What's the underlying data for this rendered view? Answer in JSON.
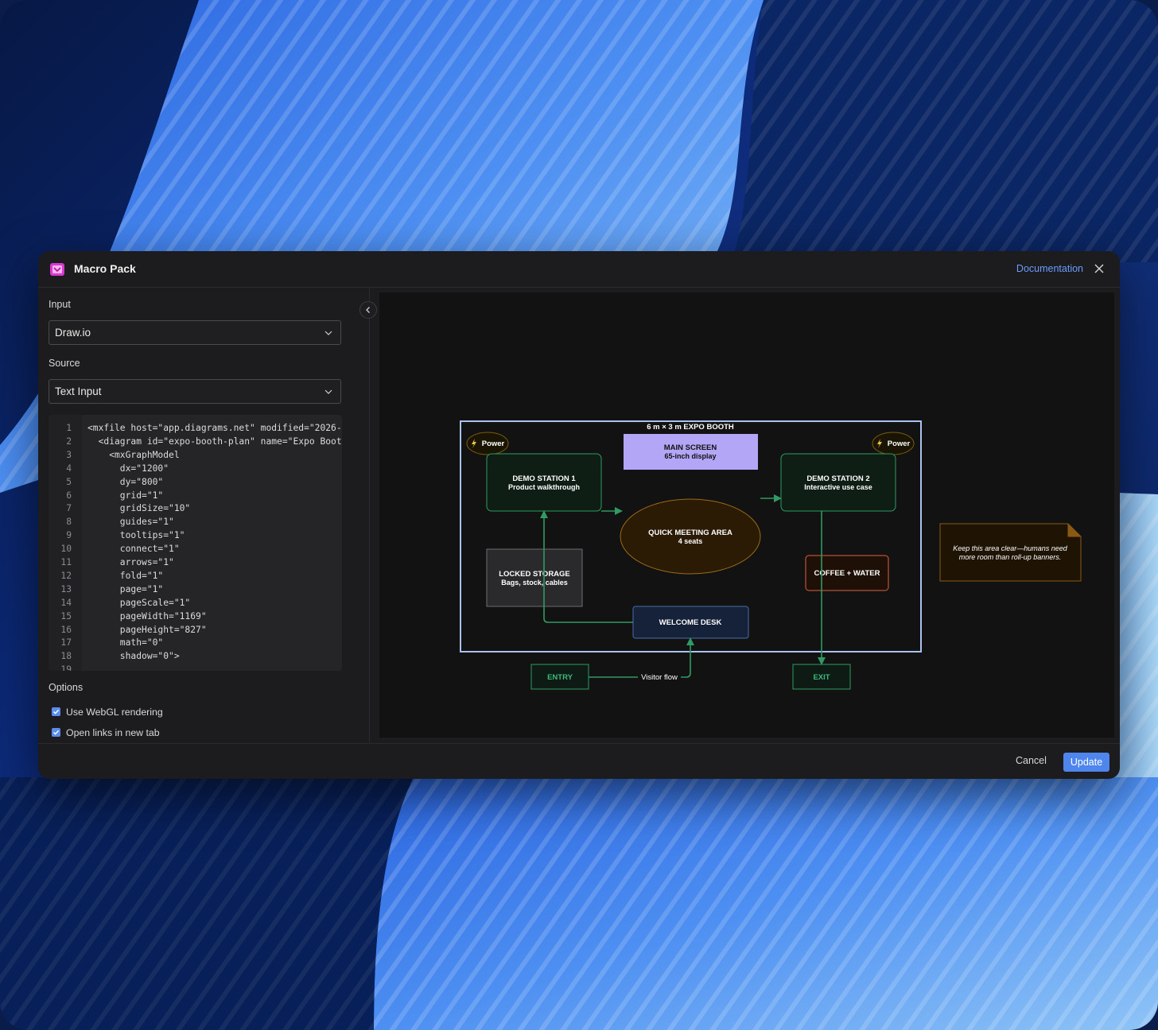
{
  "dialog": {
    "title": "Macro Pack",
    "documentation_link": "Documentation"
  },
  "input": {
    "label": "Input",
    "value": "Draw.io"
  },
  "source": {
    "label": "Source",
    "value": "Text Input"
  },
  "code_lines": [
    {
      "n": "1",
      "text": "<mxfile host=\"app.diagrams.net\" modified=\"2026-"
    },
    {
      "n": "2",
      "text": "  <diagram id=\"expo-booth-plan\" name=\"Expo Boot"
    },
    {
      "n": "3",
      "text": "    <mxGraphModel"
    },
    {
      "n": "4",
      "text": "      dx=\"1200\""
    },
    {
      "n": "5",
      "text": "      dy=\"800\""
    },
    {
      "n": "6",
      "text": "      grid=\"1\""
    },
    {
      "n": "7",
      "text": "      gridSize=\"10\""
    },
    {
      "n": "8",
      "text": "      guides=\"1\""
    },
    {
      "n": "9",
      "text": "      tooltips=\"1\""
    },
    {
      "n": "10",
      "text": "      connect=\"1\""
    },
    {
      "n": "11",
      "text": "      arrows=\"1\""
    },
    {
      "n": "12",
      "text": "      fold=\"1\""
    },
    {
      "n": "13",
      "text": "      page=\"1\""
    },
    {
      "n": "14",
      "text": "      pageScale=\"1\""
    },
    {
      "n": "15",
      "text": "      pageWidth=\"1169\""
    },
    {
      "n": "16",
      "text": "      pageHeight=\"827\""
    },
    {
      "n": "17",
      "text": "      math=\"0\""
    },
    {
      "n": "18",
      "text": "      shadow=\"0\">"
    },
    {
      "n": "19",
      "text": ""
    }
  ],
  "options": {
    "label": "Options",
    "webgl": {
      "label": "Use WebGL rendering",
      "checked": true
    },
    "new_tab": {
      "label": "Open links in new tab",
      "checked": true
    }
  },
  "footer": {
    "cancel": "Cancel",
    "update": "Update"
  },
  "diagram": {
    "booth_title": "6 m × 3 m EXPO BOOTH",
    "power_left": "Power",
    "power_right": "Power",
    "main_screen": {
      "line1": "MAIN SCREEN",
      "line2": "65-inch display"
    },
    "demo1": {
      "line1": "DEMO STATION 1",
      "line2": "Product walkthrough"
    },
    "demo2": {
      "line1": "DEMO STATION 2",
      "line2": "Interactive use case"
    },
    "meeting": {
      "line1": "QUICK MEETING AREA",
      "line2": "4 seats"
    },
    "storage": {
      "line1": "LOCKED STORAGE",
      "line2": "Bags, stock, cables"
    },
    "coffee": "COFFEE + WATER",
    "welcome": "WELCOME DESK",
    "entry": "ENTRY",
    "exit": "EXIT",
    "flow_label": "Visitor flow",
    "note": {
      "line1": "Keep this area clear—humans need",
      "line2": "more room than roll-up banners."
    },
    "colors": {
      "booth_border": "#a9c2f0",
      "green": "#2f9a63",
      "main_screen": "#b4a6f7",
      "meeting_fill": "#2b1a04",
      "meeting_stroke": "#9a6a1a",
      "coffee_stroke": "#d9623f",
      "welcome_fill": "#15223a"
    }
  }
}
